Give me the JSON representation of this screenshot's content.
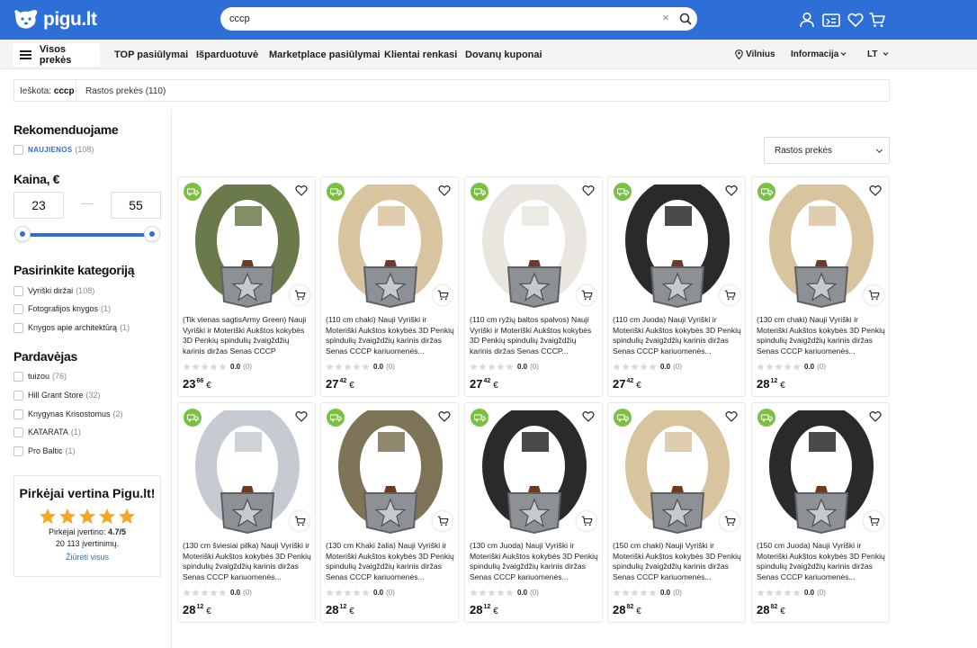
{
  "header": {
    "logo_text": "pigu.lt",
    "search": {
      "value": "cccp",
      "clear_label": "×"
    },
    "icons": [
      "user-icon",
      "orders-icon",
      "heart-icon",
      "cart-icon"
    ],
    "brand_color": "#2d6fd6"
  },
  "nav": {
    "all_label": "Visos prekės",
    "items": [
      "TOP pasiūlymai",
      "Išparduotuvė",
      "Marketplace pasiūlymai",
      "Klientai renkasi",
      "Dovanų kuponai"
    ],
    "city": "Vilnius",
    "info": "Informacija",
    "lang": "LT"
  },
  "breadcrumb": {
    "search_label": "Ieškota:",
    "query": "cccp",
    "found": "Rastos prekės (110)"
  },
  "filters": {
    "recommend": {
      "title": "Rekomenduojame",
      "items": [
        {
          "label": "NAUJIENOS",
          "count": "(108)"
        }
      ]
    },
    "price": {
      "title": "Kaina, €",
      "min": "23",
      "max": "55"
    },
    "category": {
      "title": "Pasirinkite kategoriją",
      "items": [
        {
          "label": "Vyriški diržai",
          "count": "(108)"
        },
        {
          "label": "Fotografijos knygos",
          "count": "(1)"
        },
        {
          "label": "Knygos apie architektūrą",
          "count": "(1)"
        }
      ]
    },
    "seller": {
      "title": "Pardavėjas",
      "items": [
        {
          "label": "tuizou",
          "count": "(76)"
        },
        {
          "label": "Hill Grant Store",
          "count": "(32)"
        },
        {
          "label": "Knygynas Krisostomus",
          "count": "(2)"
        },
        {
          "label": "KATARATA",
          "count": "(1)"
        },
        {
          "label": "Pro Baltic",
          "count": "(1)"
        }
      ]
    }
  },
  "rating_box": {
    "title": "Pirkėjai vertina Pigu.lt!",
    "score_label": "Pirkėjai įvertino:",
    "score": "4.7/5",
    "reviews": "20 113 įvertinimų.",
    "link": "Žiūrėti visus",
    "star_color": "#f5a623"
  },
  "sort": {
    "label": "Rastos prekės"
  },
  "products": [
    {
      "title": "(Tik vienas sagtisArmy Green) Nauji Vyriški ir Moteriški Aukštos kokybės 3D Penkių spindulių žvaigždžių karinis diržas Senas CCCP kariuomenės...",
      "belt_color": "#6b7a4b",
      "rating": "0.0",
      "reviews": "(0)",
      "price_int": "23",
      "price_dec": "66",
      "currency": "€"
    },
    {
      "title": "(110 cm chaki) Nauji Vyriški ir Moteriški Aukštos kokybės 3D Penkių spindulių žvaigždžių karinis diržas Senas CCCP kariuomenės...",
      "belt_color": "#d9c4a0",
      "rating": "0.0",
      "reviews": "(0)",
      "price_int": "27",
      "price_dec": "42",
      "currency": "€"
    },
    {
      "title": "(110 cm ryžių baltos spalvos) Nauji Vyriški ir Moteriški Aukštos kokybės 3D Penkių spindulių žvaigždžių karinis diržas Senas CCCP...",
      "belt_color": "#e8e6de",
      "rating": "0.0",
      "reviews": "(0)",
      "price_int": "27",
      "price_dec": "42",
      "currency": "€"
    },
    {
      "title": "(110 cm Juoda) Nauji Vyriški ir Moteriški Aukštos kokybės 3D Penkių spindulių žvaigždžių karinis diržas Senas CCCP kariuomenės...",
      "belt_color": "#2a2a2a",
      "rating": "0.0",
      "reviews": "(0)",
      "price_int": "27",
      "price_dec": "42",
      "currency": "€"
    },
    {
      "title": "(130 cm chaki) Nauji Vyriški ir Moteriški Aukštos kokybės 3D Penkių spindulių žvaigždžių karinis diržas Senas CCCP kariuomenės...",
      "belt_color": "#d9c4a0",
      "rating": "0.0",
      "reviews": "(0)",
      "price_int": "28",
      "price_dec": "12",
      "currency": "€"
    },
    {
      "title": "(130 cm šviesiai pilka) Nauji Vyriški ir Moteriški Aukštos kokybės 3D Penkių spindulių žvaigždžių karinis diržas Senas CCCP kariuomenės...",
      "belt_color": "#c6cbd1",
      "rating": "0.0",
      "reviews": "(0)",
      "price_int": "28",
      "price_dec": "12",
      "currency": "€"
    },
    {
      "title": "(130 cm Khaki žalia) Nauji Vyriški ir Moteriški Aukštos kokybės 3D Penkių spindulių žvaigždžių karinis diržas Senas CCCP kariuomenės...",
      "belt_color": "#7d7457",
      "rating": "0.0",
      "reviews": "(0)",
      "price_int": "28",
      "price_dec": "12",
      "currency": "€"
    },
    {
      "title": "(130 cm Juoda) Nauji Vyriški ir Moteriški Aukštos kokybės 3D Penkių spindulių žvaigždžių karinis diržas Senas CCCP kariuomenės...",
      "belt_color": "#2a2a2a",
      "rating": "0.0",
      "reviews": "(0)",
      "price_int": "28",
      "price_dec": "12",
      "currency": "€"
    },
    {
      "title": "(150 cm chaki) Nauji Vyriški ir Moteriški Aukštos kokybės 3D Penkių spindulių žvaigždžių karinis diržas Senas CCCP kariuomenės...",
      "belt_color": "#d9c4a0",
      "rating": "0.0",
      "reviews": "(0)",
      "price_int": "28",
      "price_dec": "82",
      "currency": "€"
    },
    {
      "title": "(150 cm Juoda) Nauji Vyriški ir Moteriški Aukštos kokybės 3D Penkių spindulių žvaigždžių karinis diržas Senas CCCP kariuomenės...",
      "belt_color": "#2a2a2a",
      "rating": "0.0",
      "reviews": "(0)",
      "price_int": "28",
      "price_dec": "82",
      "currency": "€"
    }
  ]
}
